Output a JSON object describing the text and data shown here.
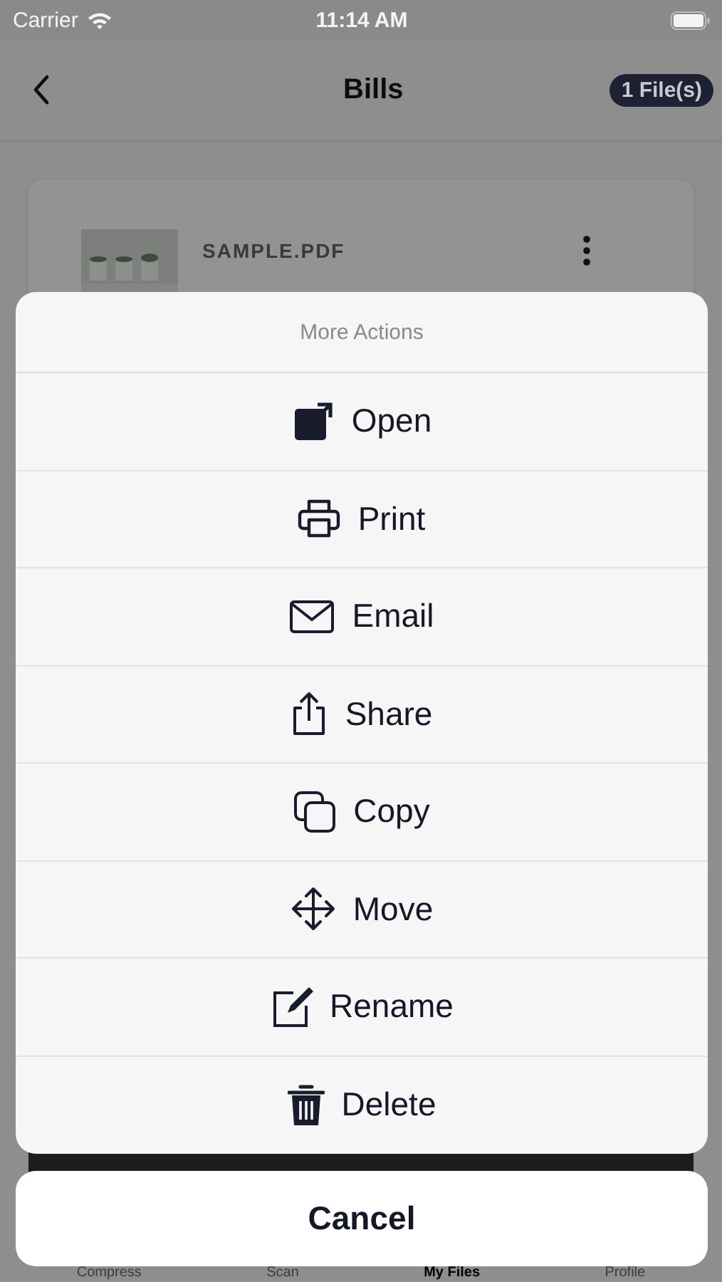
{
  "status_bar": {
    "carrier": "Carrier",
    "time": "11:14 AM"
  },
  "nav": {
    "title": "Bills",
    "badge": "1 File(s)"
  },
  "files": [
    {
      "name": "SAMPLE.PDF"
    }
  ],
  "sheet": {
    "title": "More Actions",
    "actions": [
      {
        "label": "Open",
        "kind": "open"
      },
      {
        "label": "Print",
        "kind": "print"
      },
      {
        "label": "Email",
        "kind": "email"
      },
      {
        "label": "Share",
        "kind": "share"
      },
      {
        "label": "Copy",
        "kind": "copy"
      },
      {
        "label": "Move",
        "kind": "move"
      },
      {
        "label": "Rename",
        "kind": "rename"
      },
      {
        "label": "Delete",
        "kind": "delete"
      }
    ],
    "cancel": "Cancel"
  },
  "tab_bar": [
    {
      "label": "Compress",
      "selected": false
    },
    {
      "label": "Scan",
      "selected": false
    },
    {
      "label": "My Files",
      "selected": true
    },
    {
      "label": "Profile",
      "selected": false
    }
  ]
}
